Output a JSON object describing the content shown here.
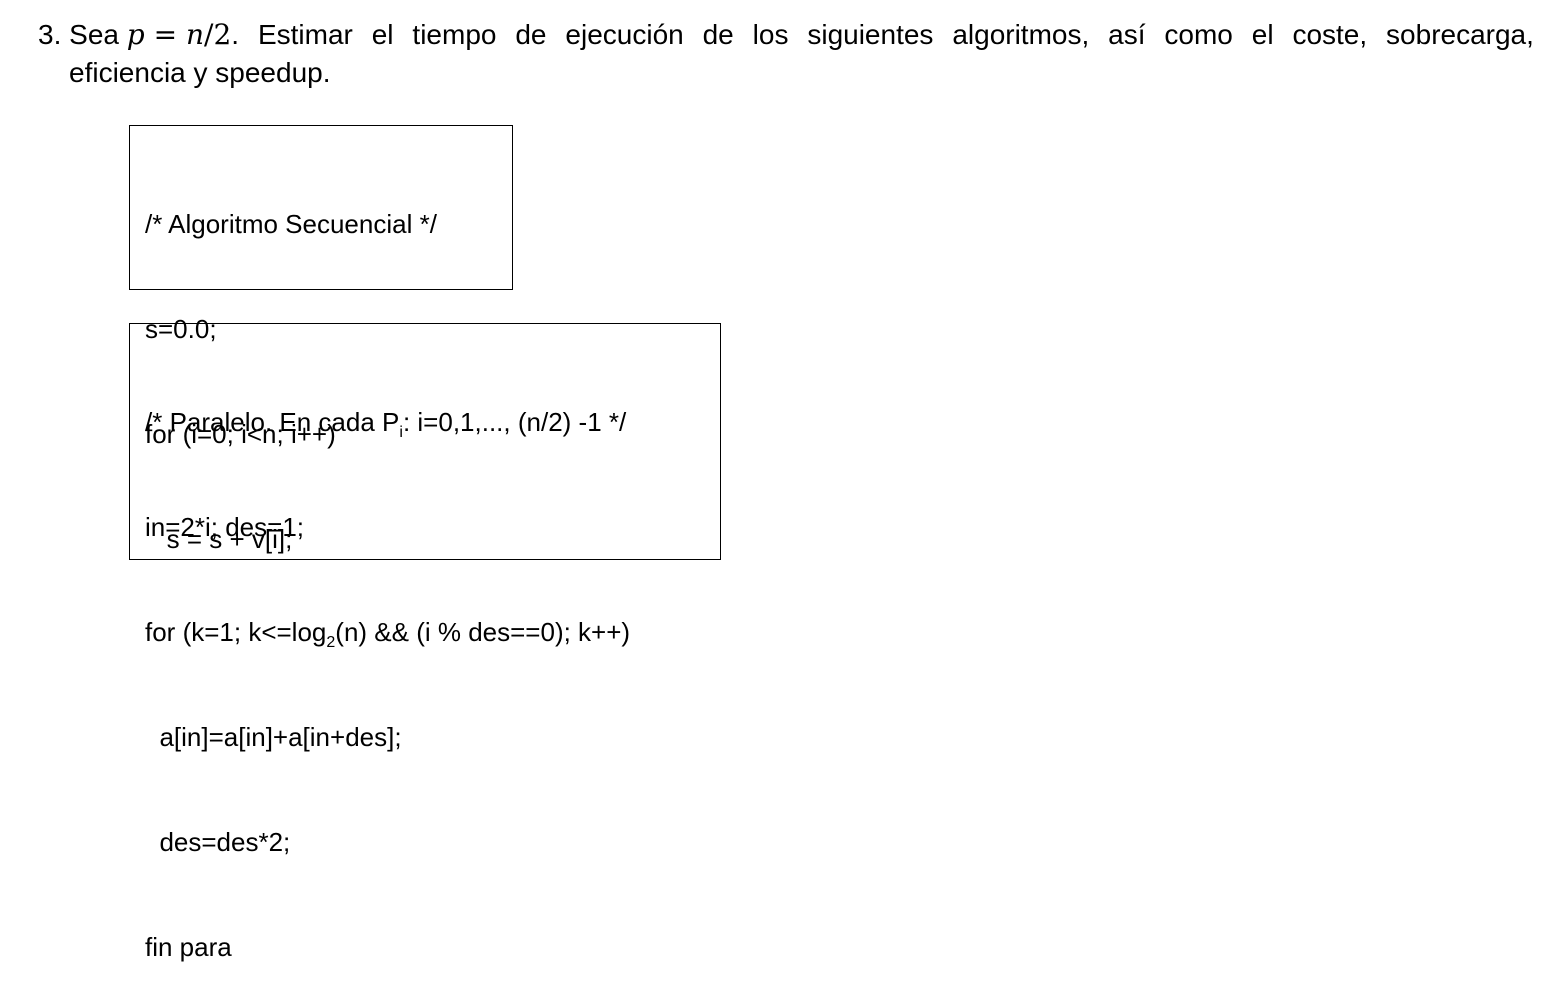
{
  "problem": {
    "number": "3.",
    "intro": "Sea",
    "formula": {
      "lhs": "p",
      "eq": "=",
      "rhs_var": "n",
      "rhs_rest": "/2"
    },
    "line1_words": [
      "Estimar",
      "el",
      "tiempo",
      "de",
      "ejecución",
      "de",
      "los",
      "siguientes",
      "algoritmos,",
      "así",
      "como",
      "el",
      "coste,",
      "sobrecarga,"
    ],
    "line2": "eficiencia y speedup."
  },
  "sequential_code": {
    "lines": [
      "/* Algoritmo Secuencial */",
      "s=0.0;",
      "for (i=0; i<n; i++)",
      "   s = s + v[i];"
    ]
  },
  "parallel_code": {
    "line1_pre": "/* Paralelo. En cada P",
    "line1_sub": "i",
    "line1_post": ": i=0,1,..., (n/2) -1 */",
    "line2": "in=2*i; des=1;",
    "line3_pre": "for (k=1; k<=log",
    "line3_sub": "2",
    "line3_post": "(n) && (i % des==0); k++)",
    "line4": "  a[in]=a[in]+a[in+des];",
    "line5": "  des=des*2;",
    "line6": "fin para"
  }
}
